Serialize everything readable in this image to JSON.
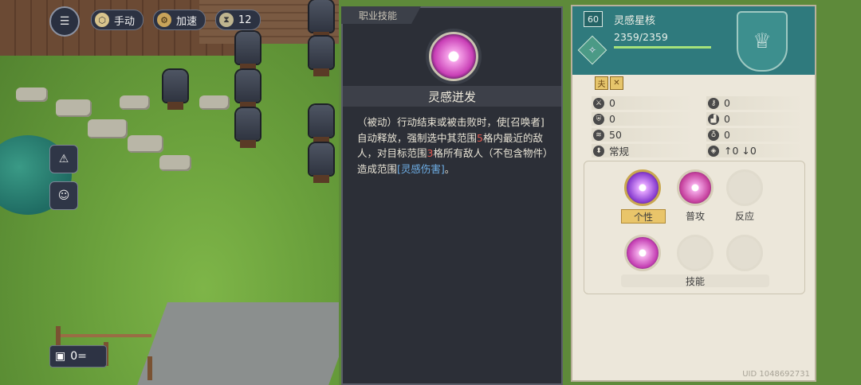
{
  "hud": {
    "mode_label": "手动",
    "speed_label": "加速",
    "turn_count": "12",
    "counter_value": "0="
  },
  "skill_panel": {
    "tab_label": "职业技能",
    "skill_name": "灵感迸发",
    "desc_parts": [
      "（被动）行动结束或被击败时，使[召唤者]自动释放，强制选中其范围",
      "5",
      "格内最近的敌人，对目标范围",
      "3",
      "格所有敌人（不包含物件）造成范围",
      "[灵感伤害]",
      "。"
    ]
  },
  "character": {
    "level": "60",
    "name": "灵感星核",
    "hp_text": "2359/2359",
    "hp_ratio": 1.0,
    "stats": {
      "attack": "0",
      "key": "0",
      "defense": "0",
      "boot": "0",
      "move": "50",
      "foot": "0",
      "type": "常规",
      "elev": "↑0 ↓0"
    },
    "skill_slots": {
      "individual": "个性",
      "normal": "普攻",
      "reaction": "反应",
      "skill": "技能"
    },
    "uid": "UID 1048692731"
  }
}
